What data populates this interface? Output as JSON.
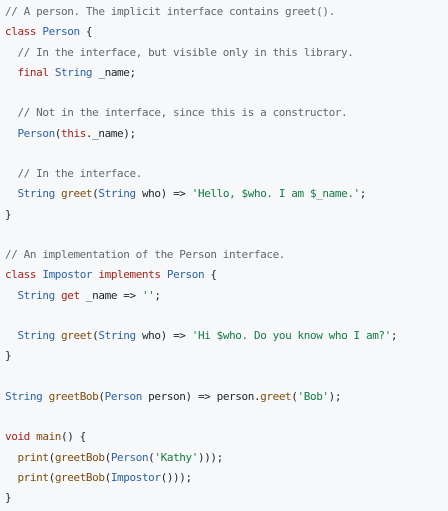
{
  "code": {
    "language": "dart",
    "colors": {
      "background": "#f7f8f9",
      "comment": "#606770",
      "keyword": "#a1241b",
      "type": "#2b62a6",
      "func": "#7b4d12",
      "string": "#127a43",
      "plain": "#1f2328"
    },
    "lines": [
      [
        [
          "comment",
          "// A person. The implicit interface contains greet()."
        ]
      ],
      [
        [
          "keyword",
          "class"
        ],
        [
          "plain",
          " "
        ],
        [
          "type",
          "Person"
        ],
        [
          "plain",
          " {"
        ]
      ],
      [
        [
          "plain",
          "  "
        ],
        [
          "comment",
          "// In the interface, but visible only in this library."
        ]
      ],
      [
        [
          "plain",
          "  "
        ],
        [
          "keyword",
          "final"
        ],
        [
          "plain",
          " "
        ],
        [
          "type",
          "String"
        ],
        [
          "plain",
          " _name;"
        ]
      ],
      [],
      [
        [
          "plain",
          "  "
        ],
        [
          "comment",
          "// Not in the interface, since this is a constructor."
        ]
      ],
      [
        [
          "plain",
          "  "
        ],
        [
          "type",
          "Person"
        ],
        [
          "plain",
          "("
        ],
        [
          "keyword",
          "this"
        ],
        [
          "plain",
          "._name);"
        ]
      ],
      [],
      [
        [
          "plain",
          "  "
        ],
        [
          "comment",
          "// In the interface."
        ]
      ],
      [
        [
          "plain",
          "  "
        ],
        [
          "type",
          "String"
        ],
        [
          "plain",
          " "
        ],
        [
          "func",
          "greet"
        ],
        [
          "plain",
          "("
        ],
        [
          "type",
          "String"
        ],
        [
          "plain",
          " who) => "
        ],
        [
          "string",
          "'Hello, $who. I am $_name.'"
        ],
        [
          "plain",
          ";"
        ]
      ],
      [
        [
          "plain",
          "}"
        ]
      ],
      [],
      [
        [
          "comment",
          "// An implementation of the Person interface."
        ]
      ],
      [
        [
          "keyword",
          "class"
        ],
        [
          "plain",
          " "
        ],
        [
          "type",
          "Impostor"
        ],
        [
          "plain",
          " "
        ],
        [
          "keyword",
          "implements"
        ],
        [
          "plain",
          " "
        ],
        [
          "type",
          "Person"
        ],
        [
          "plain",
          " {"
        ]
      ],
      [
        [
          "plain",
          "  "
        ],
        [
          "type",
          "String"
        ],
        [
          "plain",
          " "
        ],
        [
          "keyword",
          "get"
        ],
        [
          "plain",
          " _name => "
        ],
        [
          "string",
          "''"
        ],
        [
          "plain",
          ";"
        ]
      ],
      [],
      [
        [
          "plain",
          "  "
        ],
        [
          "type",
          "String"
        ],
        [
          "plain",
          " "
        ],
        [
          "func",
          "greet"
        ],
        [
          "plain",
          "("
        ],
        [
          "type",
          "String"
        ],
        [
          "plain",
          " who) => "
        ],
        [
          "string",
          "'Hi $who. Do you know who I am?'"
        ],
        [
          "plain",
          ";"
        ]
      ],
      [
        [
          "plain",
          "}"
        ]
      ],
      [],
      [
        [
          "type",
          "String"
        ],
        [
          "plain",
          " "
        ],
        [
          "func",
          "greetBob"
        ],
        [
          "plain",
          "("
        ],
        [
          "type",
          "Person"
        ],
        [
          "plain",
          " person) => person."
        ],
        [
          "func",
          "greet"
        ],
        [
          "plain",
          "("
        ],
        [
          "string",
          "'Bob'"
        ],
        [
          "plain",
          ");"
        ]
      ],
      [],
      [
        [
          "keyword",
          "void"
        ],
        [
          "plain",
          " "
        ],
        [
          "func",
          "main"
        ],
        [
          "plain",
          "() {"
        ]
      ],
      [
        [
          "plain",
          "  "
        ],
        [
          "func",
          "print"
        ],
        [
          "plain",
          "("
        ],
        [
          "func",
          "greetBob"
        ],
        [
          "plain",
          "("
        ],
        [
          "type",
          "Person"
        ],
        [
          "plain",
          "("
        ],
        [
          "string",
          "'Kathy'"
        ],
        [
          "plain",
          ")));"
        ]
      ],
      [
        [
          "plain",
          "  "
        ],
        [
          "func",
          "print"
        ],
        [
          "plain",
          "("
        ],
        [
          "func",
          "greetBob"
        ],
        [
          "plain",
          "("
        ],
        [
          "type",
          "Impostor"
        ],
        [
          "plain",
          "()));"
        ]
      ],
      [
        [
          "plain",
          "}"
        ]
      ]
    ]
  }
}
